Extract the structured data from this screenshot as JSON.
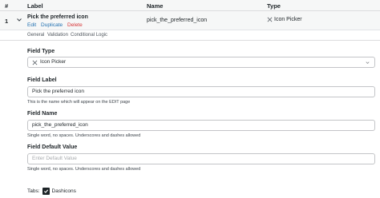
{
  "table_header": {
    "order": "#",
    "label": "Label",
    "name": "Name",
    "type": "Type"
  },
  "field_row": {
    "number": "1",
    "label": "Pick the preferred icon",
    "actions": {
      "edit": "Edit",
      "duplicate": "Duplicate",
      "delete": "Delete"
    },
    "name": "pick_the_preferred_icon",
    "type": "Icon Picker",
    "type_icon": "icon-picker-icon"
  },
  "settings_tabs": [
    "General",
    "Validation",
    "Conditional Logic"
  ],
  "field_type": {
    "label": "Field Type",
    "value": "Icon Picker",
    "icon": "icon-picker-icon"
  },
  "field_label": {
    "label": "Field Label",
    "value": "Pick the preferred icon",
    "help": "This is the name which will appear on the EDIT page"
  },
  "field_name": {
    "label": "Field Name",
    "value": "pick_the_preferred_icon",
    "help": "Single word, no spaces. Underscores and dashes allowed"
  },
  "field_default": {
    "label": "Field Default Value",
    "placeholder": "Enter Default Value",
    "help": "Single word, no spaces. Underscores and dashes allowed"
  },
  "tabs_option": {
    "label": "Tabs:",
    "option": "Dashicons",
    "checked": true
  },
  "colors": {
    "link": "#2271b1",
    "delete": "#d63638",
    "header_bg": "#f6f7f7"
  }
}
